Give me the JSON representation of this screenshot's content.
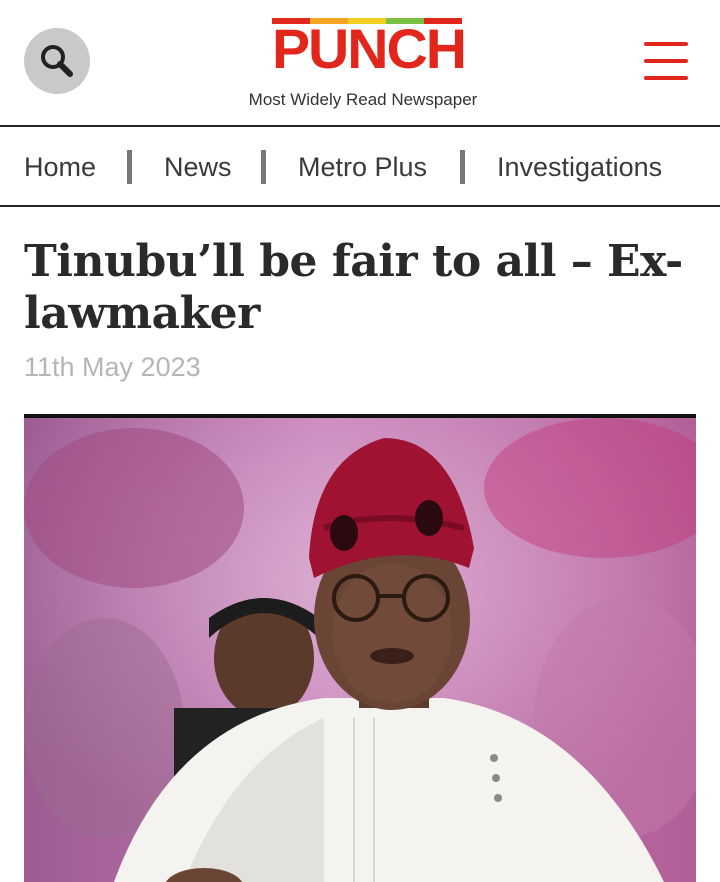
{
  "header": {
    "logo_text": "PUNCH",
    "tagline": "Most Widely Read Newspaper",
    "search_icon": "search-icon",
    "menu_icon": "hamburger-menu-icon"
  },
  "nav": {
    "items": [
      {
        "label": "Home"
      },
      {
        "label": "News"
      },
      {
        "label": "Metro Plus"
      },
      {
        "label": "Investigations"
      }
    ]
  },
  "article": {
    "headline": "Tinubu’ll be fair to all – Ex-lawmaker",
    "date": "11th May 2023",
    "image_description": "Photo of a man in a red cap and white agbada"
  },
  "colors": {
    "brand_red": "#e3261c",
    "logo_bar_colors": [
      "#e3261c",
      "#f5a623",
      "#f2d01f",
      "#7ac143",
      "#e3261c"
    ],
    "date_gray": "#b5b5b5",
    "photo_bg": "#b06aa5"
  }
}
